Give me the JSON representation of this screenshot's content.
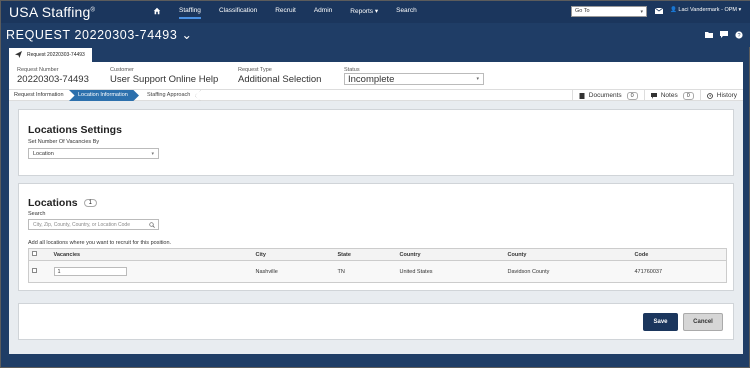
{
  "app": {
    "logo": "USA Staffing",
    "logo_mark": "®"
  },
  "nav": {
    "items": [
      {
        "label": "Staffing",
        "active": true
      },
      {
        "label": "Classification",
        "active": false
      },
      {
        "label": "Recruit",
        "active": false
      },
      {
        "label": "Admin",
        "active": false
      },
      {
        "label": "Reports",
        "active": false,
        "dropdown": true
      },
      {
        "label": "Search",
        "active": false
      }
    ],
    "goto_placeholder": "Go To",
    "user": "Laci Vandermark - OPM"
  },
  "request": {
    "title": "REQUEST 20220303-74493",
    "tab_label": "Request 20220303-74493",
    "fields": {
      "number_label": "Request Number",
      "number_value": "20220303-74493",
      "customer_label": "Customer",
      "customer_value": "User Support Online Help",
      "type_label": "Request Type",
      "type_value": "Additional Selection",
      "status_label": "Status",
      "status_value": "Incomplete"
    }
  },
  "workflow": {
    "steps": [
      "Request Information",
      "Location Information",
      "Staffing Approach"
    ],
    "documents_label": "Documents",
    "documents_count": "0",
    "notes_label": "Notes",
    "notes_count": "0",
    "history_label": "History"
  },
  "locations_settings": {
    "title": "Locations Settings",
    "set_label": "Set Number Of Vacancies By",
    "set_value": "Location"
  },
  "locations": {
    "title": "Locations",
    "count": "1",
    "search_label": "Search",
    "search_placeholder": "City, Zip, County, Country, or Location Code",
    "helper": "Add all locations where you want to recruit for this position.",
    "columns": [
      "Vacancies",
      "City",
      "State",
      "Country",
      "County",
      "Code"
    ],
    "rows": [
      {
        "vacancies": "1",
        "city": "Nashville",
        "state": "TN",
        "country": "United States",
        "county": "Davidson County",
        "code": "471760037"
      }
    ]
  },
  "actions": {
    "save": "Save",
    "cancel": "Cancel"
  },
  "colors": {
    "nav_bg": "#1b365d",
    "accent": "#2c70ad",
    "page_bg": "#1f3d66"
  }
}
